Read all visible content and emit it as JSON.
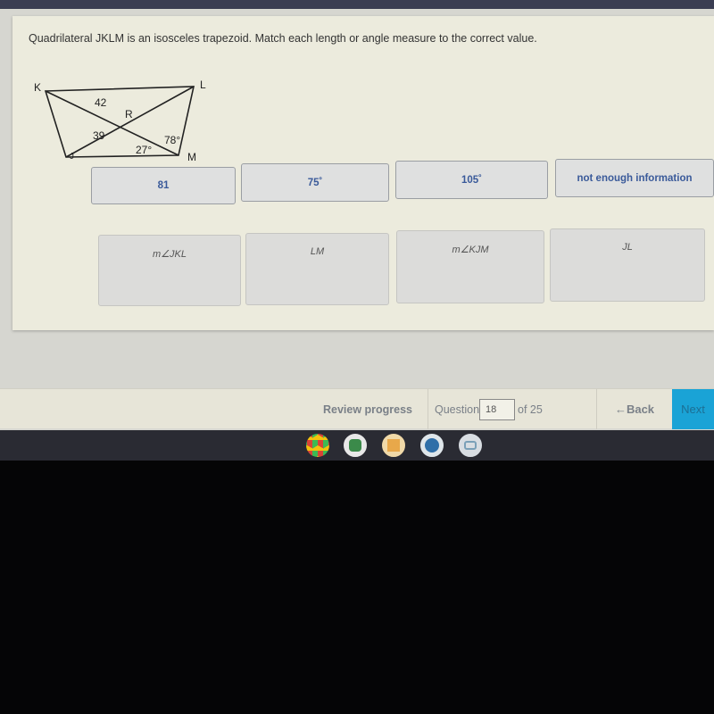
{
  "question": {
    "prompt": "Quadrilateral JKLM is an isosceles trapezoid. Match each length or angle measure to the correct value.",
    "diagram": {
      "vertices": [
        "K",
        "L",
        "M",
        "J"
      ],
      "center_label": "R",
      "labels": {
        "KR": "42",
        "JR": "39",
        "angle_RMJ": "27°",
        "angle_RML": "78°"
      }
    },
    "answer_tiles": [
      "81",
      "75˚",
      "105˚",
      "not enough information"
    ],
    "targets": [
      "m∠JKL",
      "LM",
      "m∠KJM",
      "JL"
    ]
  },
  "nav": {
    "review_label": "Review progress",
    "question_label": "Question",
    "question_number": "18",
    "of_label": "of 25",
    "back_label": "Back",
    "next_label": "Next"
  },
  "taskbar": {
    "apps": [
      "chrome-icon",
      "backpack-app-icon",
      "notes-app-icon",
      "blue-app-icon",
      "gray-app-icon"
    ]
  }
}
